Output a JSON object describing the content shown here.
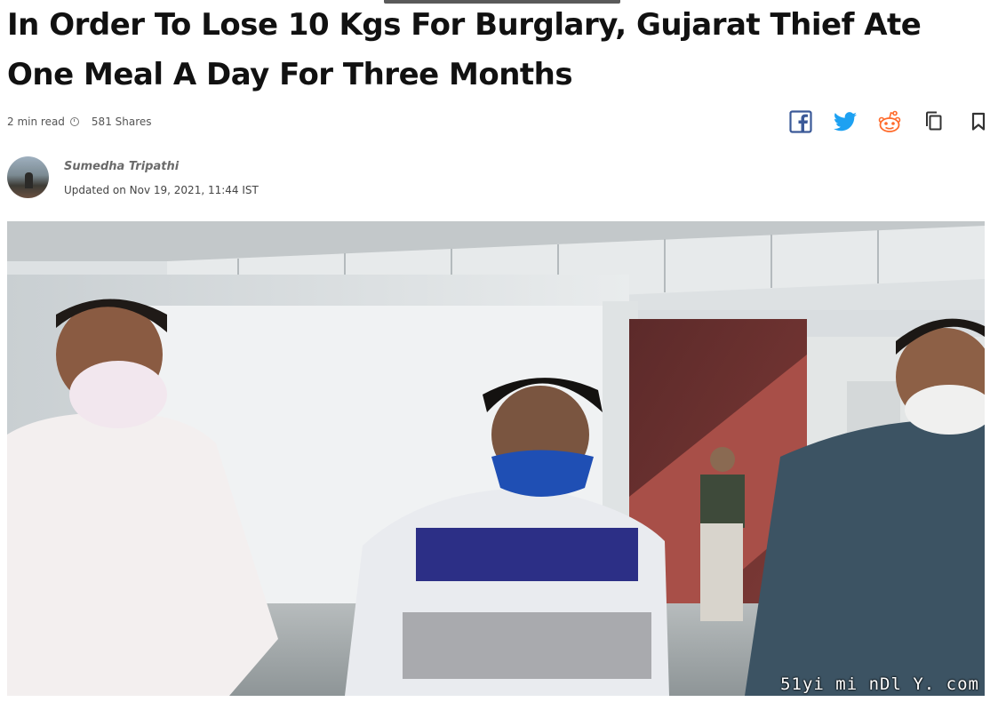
{
  "article": {
    "headline_line1": "In Order To Lose 10 Kgs For Burglary, Gujarat Thief Ate",
    "headline_line2": "One Meal A Day For Three Months",
    "read_time": "2 min read",
    "shares": "581 Shares"
  },
  "share": {
    "icons": [
      "facebook-icon",
      "twitter-icon",
      "reddit-icon",
      "copy-icon",
      "bookmark-icon"
    ],
    "colors": {
      "facebook": "#3b5998",
      "twitter": "#1da1f2",
      "reddit": "#ff6a2a",
      "neutral": "#333333"
    }
  },
  "author": {
    "name": "Sumedha Tripathi",
    "updated": "Updated on Nov 19, 2021, 11:44 IST"
  },
  "hero": {
    "watermark": "51yi mi nDl Y. com"
  }
}
